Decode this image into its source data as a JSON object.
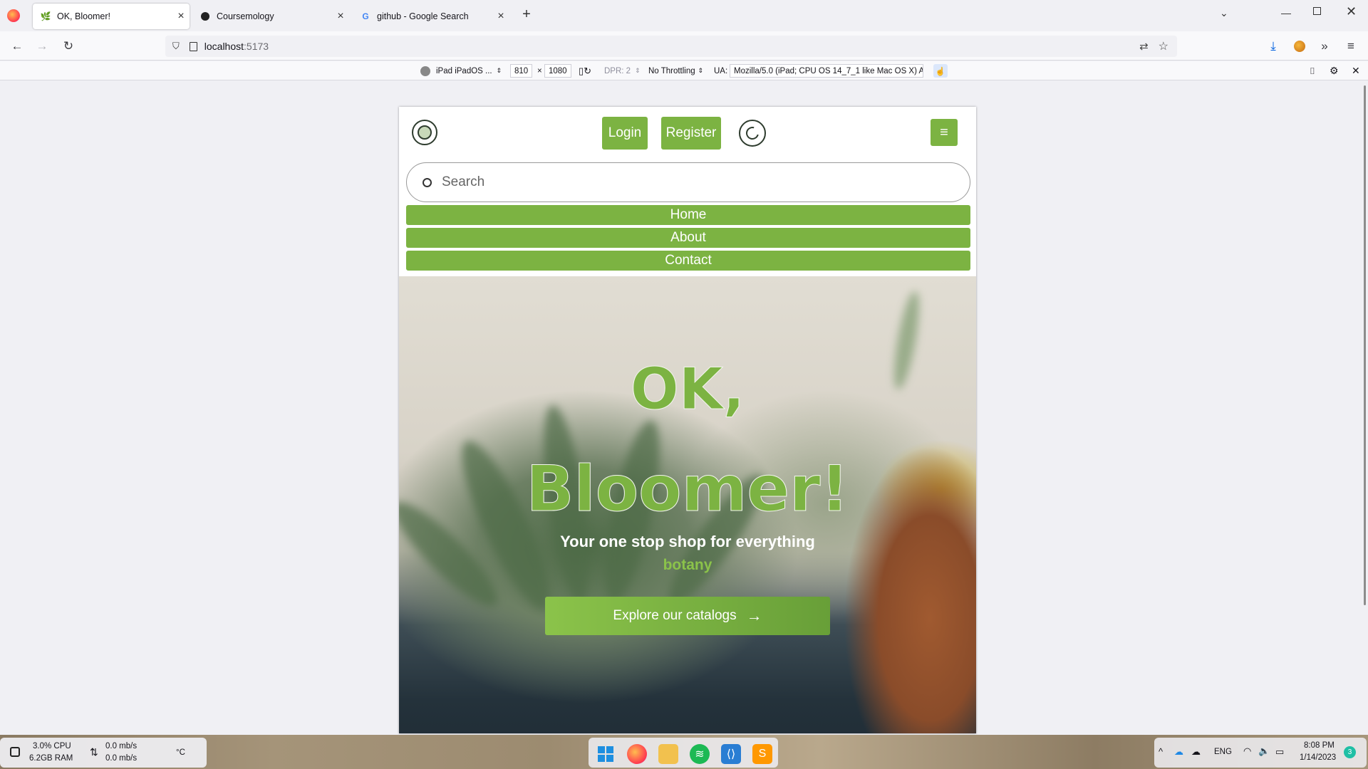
{
  "browser": {
    "tabs": [
      {
        "label": "OK, Bloomer!",
        "active": true,
        "icon": "plant-favicon"
      },
      {
        "label": "Coursemology",
        "active": false,
        "icon": "coursemology-favicon"
      },
      {
        "label": "github - Google Search",
        "active": false,
        "icon": "google-favicon"
      }
    ],
    "url": {
      "host": "localhost",
      "port": ":5173"
    },
    "responsive": {
      "device": "iPad iPadOS ...",
      "width": "810",
      "height": "1080",
      "dpr": "DPR: 2",
      "throttling": "No Throttling",
      "ua_label": "UA:",
      "ua_value": "Mozilla/5.0 (iPad; CPU OS 14_7_1 like Mac OS X) Ap"
    }
  },
  "site": {
    "login": "Login",
    "register": "Register",
    "search_placeholder": "Search",
    "nav": [
      "Home",
      "About",
      "Contact"
    ],
    "hero_title_line1": "OK,",
    "hero_title_line2": "Bloomer!",
    "hero_sub1": "Your one stop shop for everything",
    "hero_sub2": "botany",
    "cta": "Explore our catalogs",
    "accent": "#7cb342"
  },
  "taskbar": {
    "cpu": "3.0% CPU",
    "ram": "6.2GB RAM",
    "up": "0.0 mb/s",
    "down": "0.0 mb/s",
    "temp": "°C",
    "lang": "ENG",
    "time": "8:08 PM",
    "date": "1/14/2023",
    "notif": "3"
  }
}
